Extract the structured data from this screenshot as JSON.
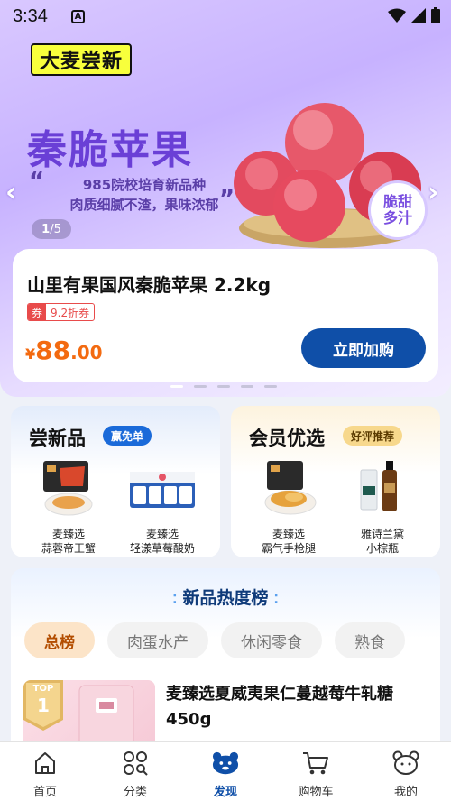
{
  "status_bar": {
    "time": "3:34",
    "a_icon": "A"
  },
  "hero": {
    "brand_tag": "大麦尝新",
    "title": "秦脆苹果",
    "subtitle_line1": "985院校培育新品种",
    "subtitle_line2": "肉质细腻不渣，果味浓郁",
    "badge_line1": "脆甜",
    "badge_line2": "多汁",
    "page_current": "1",
    "page_total": "/5",
    "product": {
      "name": "山里有果国风秦脆苹果 2.2kg",
      "coupon_tag": "券",
      "coupon_text": "9.2折券",
      "price_currency": "¥",
      "price_int": "88",
      "price_dec": ".00",
      "buy_label": "立即加购"
    },
    "carousel_active_index": 0,
    "carousel_count": 5
  },
  "new_products": {
    "title": "尝新品",
    "tag": "赢免单",
    "items": [
      {
        "brand": "麦臻选",
        "name": "蒜蓉帝王蟹"
      },
      {
        "brand": "麦臻选",
        "name": "轻漾草莓酸奶"
      }
    ]
  },
  "member": {
    "title": "会员优选",
    "tag": "好评推荐",
    "items": [
      {
        "brand": "麦臻选",
        "name": "霸气手枪腿"
      },
      {
        "brand": "雅诗兰黛",
        "name": "小棕瓶"
      }
    ]
  },
  "ranking": {
    "title": "新品热度榜",
    "chips": [
      "总榜",
      "肉蛋水产",
      "休闲零食",
      "熟食"
    ],
    "active_chip": 0,
    "top_badge_label": "TOP",
    "top_badge_number": "1",
    "item_name": "麦臻选夏威夷果仁蔓越莓牛轧糖450g"
  },
  "tab_bar": {
    "tabs": [
      "首页",
      "分类",
      "发现",
      "购物车",
      "我的"
    ],
    "active": 2
  },
  "colors": {
    "accent": "#0f4fa8",
    "price": "#f36a10",
    "hero_title": "#6a3fd6",
    "coupon": "#e84b4b"
  }
}
